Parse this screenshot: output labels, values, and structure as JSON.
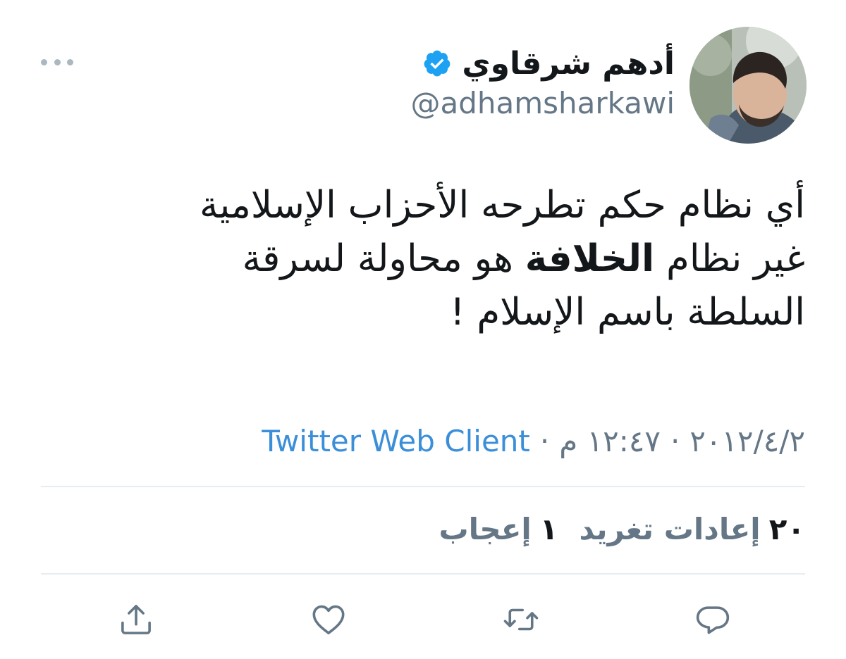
{
  "author": {
    "display_name": "أدهم شرقاوي",
    "handle": "@adhamsharkawi",
    "verified": true
  },
  "tweet": {
    "lines": [
      "أي نظام حكم تطرحه الأحزاب الإسلامية",
      {
        "before": "غير نظام ",
        "bold": "الخلافة",
        "after": " هو محاولة لسرقة"
      },
      "السلطة باسم الإسلام !"
    ]
  },
  "meta": {
    "date": "٢٠١٢/٤/٢",
    "separator": "·",
    "time": "١٢:٤٧ م",
    "client": "Twitter Web Client"
  },
  "stats": {
    "retweets_count": "٢٠",
    "retweets_label": "إعادات تغريد",
    "likes_count": "١",
    "likes_label": "إعجاب"
  },
  "icons": {
    "more": "more-horizontal-icon",
    "verified": "verified-badge-icon",
    "reply": "reply-icon",
    "retweet": "retweet-icon",
    "like": "heart-icon",
    "share": "share-icon"
  },
  "colors": {
    "text": "#14171a",
    "secondary": "#657786",
    "link": "#3b8fd9",
    "verified": "#1da1f2",
    "icon": "#657786",
    "divider": "#e6ecf0"
  }
}
